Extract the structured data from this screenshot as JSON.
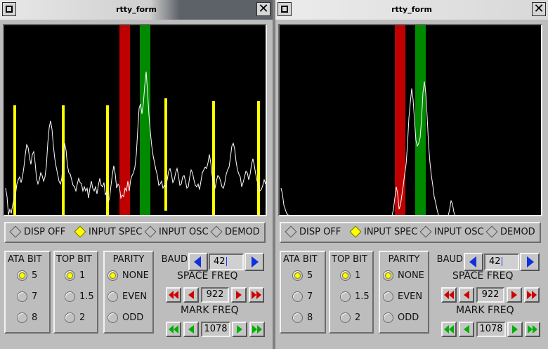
{
  "windows": [
    {
      "title": "rtty_form",
      "active": true,
      "scope": {
        "markers": {
          "space_color": "#c00000",
          "mark_color": "#008a00",
          "bit_marker_color": "#ffff00"
        },
        "trace_color": "#ffffff",
        "bit_markers": true,
        "trace": [
          [
            2,
            232
          ],
          [
            4,
            244
          ],
          [
            6,
            270
          ],
          [
            8,
            262
          ],
          [
            10,
            268
          ],
          [
            12,
            256
          ],
          [
            14,
            248
          ],
          [
            16,
            242
          ],
          [
            18,
            226
          ],
          [
            20,
            220
          ],
          [
            22,
            216
          ],
          [
            24,
            224
          ],
          [
            26,
            216
          ],
          [
            28,
            202
          ],
          [
            30,
            184
          ],
          [
            32,
            170
          ],
          [
            34,
            174
          ],
          [
            36,
            188
          ],
          [
            38,
            198
          ],
          [
            40,
            184
          ],
          [
            42,
            180
          ],
          [
            44,
            196
          ],
          [
            46,
            218
          ],
          [
            48,
            226
          ],
          [
            50,
            220
          ],
          [
            52,
            210
          ],
          [
            54,
            214
          ],
          [
            56,
            222
          ],
          [
            58,
            216
          ],
          [
            60,
            200
          ],
          [
            62,
            168
          ],
          [
            64,
            146
          ],
          [
            66,
            136
          ],
          [
            68,
            148
          ],
          [
            70,
            172
          ],
          [
            72,
            190
          ],
          [
            74,
            202
          ],
          [
            76,
            212
          ],
          [
            78,
            222
          ],
          [
            80,
            226
          ],
          [
            82,
            218
          ],
          [
            84,
            190
          ],
          [
            86,
            168
          ],
          [
            88,
            178
          ],
          [
            90,
            200
          ],
          [
            92,
            210
          ],
          [
            94,
            212
          ],
          [
            96,
            220
          ],
          [
            98,
            228
          ],
          [
            100,
            230
          ],
          [
            102,
            236
          ],
          [
            104,
            226
          ],
          [
            106,
            218
          ],
          [
            108,
            224
          ],
          [
            110,
            226
          ],
          [
            112,
            236
          ],
          [
            114,
            230
          ],
          [
            116,
            236
          ],
          [
            118,
            232
          ],
          [
            120,
            246
          ],
          [
            122,
            232
          ],
          [
            124,
            222
          ],
          [
            126,
            232
          ],
          [
            128,
            236
          ],
          [
            130,
            230
          ],
          [
            132,
            240
          ],
          [
            134,
            228
          ],
          [
            136,
            218
          ],
          [
            138,
            228
          ],
          [
            140,
            230
          ],
          [
            142,
            224
          ],
          [
            144,
            242
          ],
          [
            146,
            236
          ],
          [
            148,
            252
          ],
          [
            150,
            246
          ],
          [
            152,
            228
          ],
          [
            154,
            212
          ],
          [
            156,
            200
          ],
          [
            158,
            212
          ],
          [
            160,
            232
          ],
          [
            162,
            226
          ],
          [
            164,
            230
          ],
          [
            166,
            246
          ],
          [
            168,
            242
          ],
          [
            170,
            244
          ],
          [
            172,
            232
          ],
          [
            174,
            236
          ],
          [
            176,
            222
          ],
          [
            178,
            236
          ],
          [
            180,
            220
          ],
          [
            182,
            214
          ],
          [
            184,
            210
          ],
          [
            186,
            202
          ],
          [
            188,
            184
          ],
          [
            190,
            150
          ],
          [
            192,
            118
          ],
          [
            194,
            112
          ],
          [
            196,
            126
          ],
          [
            198,
            112
          ],
          [
            200,
            86
          ],
          [
            202,
            66
          ],
          [
            204,
            94
          ],
          [
            206,
            128
          ],
          [
            208,
            152
          ],
          [
            210,
            172
          ],
          [
            212,
            186
          ],
          [
            214,
            196
          ],
          [
            216,
            206
          ],
          [
            218,
            214
          ],
          [
            220,
            228
          ],
          [
            222,
            226
          ],
          [
            224,
            222
          ],
          [
            226,
            232
          ],
          [
            228,
            228
          ],
          [
            230,
            230
          ],
          [
            232,
            220
          ],
          [
            234,
            208
          ],
          [
            236,
            204
          ],
          [
            238,
            212
          ],
          [
            240,
            224
          ],
          [
            242,
            220
          ],
          [
            244,
            210
          ],
          [
            246,
            204
          ],
          [
            248,
            214
          ],
          [
            250,
            228
          ],
          [
            252,
            226
          ],
          [
            254,
            216
          ],
          [
            256,
            214
          ],
          [
            258,
            222
          ],
          [
            260,
            232
          ],
          [
            262,
            230
          ],
          [
            264,
            216
          ],
          [
            266,
            206
          ],
          [
            268,
            210
          ],
          [
            270,
            220
          ],
          [
            272,
            228
          ],
          [
            274,
            230
          ],
          [
            276,
            226
          ],
          [
            278,
            234
          ],
          [
            280,
            222
          ],
          [
            282,
            210
          ],
          [
            284,
            206
          ],
          [
            286,
            202
          ],
          [
            288,
            204
          ],
          [
            290,
            196
          ],
          [
            292,
            184
          ],
          [
            294,
            196
          ],
          [
            296,
            214
          ],
          [
            298,
            226
          ],
          [
            300,
            232
          ],
          [
            302,
            222
          ],
          [
            304,
            214
          ],
          [
            306,
            216
          ],
          [
            308,
            222
          ],
          [
            310,
            230
          ],
          [
            312,
            232
          ],
          [
            314,
            224
          ],
          [
            316,
            212
          ],
          [
            318,
            206
          ],
          [
            320,
            202
          ],
          [
            322,
            188
          ],
          [
            324,
            172
          ],
          [
            326,
            168
          ],
          [
            328,
            176
          ],
          [
            330,
            194
          ],
          [
            332,
            206
          ],
          [
            334,
            212
          ],
          [
            336,
            216
          ],
          [
            338,
            230
          ],
          [
            340,
            224
          ],
          [
            342,
            216
          ],
          [
            344,
            208
          ],
          [
            346,
            210
          ],
          [
            348,
            220
          ],
          [
            350,
            212
          ],
          [
            352,
            198
          ],
          [
            354,
            190
          ],
          [
            356,
            200
          ],
          [
            358,
            212
          ],
          [
            360,
            222
          ],
          [
            362,
            226
          ],
          [
            364,
            236
          ],
          [
            366,
            234
          ],
          [
            368,
            228
          ],
          [
            370,
            220
          ],
          [
            372,
            226
          ]
        ]
      },
      "modes": [
        {
          "label": "DISP OFF",
          "selected": false
        },
        {
          "label": "INPUT SPEC",
          "selected": true
        },
        {
          "label": "INPUT OSC",
          "selected": false
        },
        {
          "label": "DEMOD",
          "selected": false
        }
      ],
      "groups": {
        "data_bits": {
          "label": "ATA BIT",
          "options": [
            "5",
            "7",
            "8"
          ],
          "selected": "5"
        },
        "stop_bits": {
          "label": "TOP BIT",
          "options": [
            "1",
            "1.5",
            "2"
          ],
          "selected": "1"
        },
        "parity": {
          "label": "PARITY",
          "options": [
            "NONE",
            "EVEN",
            "ODD"
          ],
          "selected": "NONE"
        }
      },
      "baud": {
        "label": "BAUD",
        "value": "42"
      },
      "space_freq": {
        "label": "SPACE FREQ",
        "value": "922"
      },
      "mark_freq": {
        "label": "MARK FREQ",
        "value": "1078"
      }
    },
    {
      "title": "rtty_form",
      "active": false,
      "scope": {
        "markers": {
          "space_color": "#c00000",
          "mark_color": "#008a00",
          "bit_marker_color": "#ffff00"
        },
        "trace_color": "#ffffff",
        "bit_markers": false,
        "trace": [
          [
            2,
            232
          ],
          [
            4,
            240
          ],
          [
            6,
            256
          ],
          [
            8,
            262
          ],
          [
            10,
            268
          ],
          [
            12,
            270
          ],
          [
            14,
            271
          ],
          [
            160,
            271
          ],
          [
            162,
            262
          ],
          [
            164,
            246
          ],
          [
            166,
            230
          ],
          [
            168,
            240
          ],
          [
            170,
            262
          ],
          [
            172,
            256
          ],
          [
            174,
            242
          ],
          [
            176,
            228
          ],
          [
            178,
            212
          ],
          [
            180,
            198
          ],
          [
            182,
            170
          ],
          [
            184,
            132
          ],
          [
            186,
            110
          ],
          [
            188,
            90
          ],
          [
            190,
            106
          ],
          [
            192,
            136
          ],
          [
            194,
            164
          ],
          [
            196,
            172
          ],
          [
            198,
            168
          ],
          [
            200,
            160
          ],
          [
            202,
            134
          ],
          [
            204,
            96
          ],
          [
            206,
            80
          ],
          [
            208,
            96
          ],
          [
            210,
            130
          ],
          [
            212,
            170
          ],
          [
            214,
            196
          ],
          [
            216,
            214
          ],
          [
            218,
            228
          ],
          [
            220,
            244
          ],
          [
            222,
            252
          ],
          [
            224,
            262
          ],
          [
            226,
            270
          ],
          [
            228,
            271
          ],
          [
            240,
            271
          ],
          [
            242,
            262
          ],
          [
            244,
            250
          ],
          [
            246,
            254
          ],
          [
            248,
            266
          ],
          [
            250,
            271
          ],
          [
            372,
            271
          ]
        ]
      },
      "modes": [
        {
          "label": "DISP OFF",
          "selected": false
        },
        {
          "label": "INPUT SPEC",
          "selected": true
        },
        {
          "label": "INPUT OSC",
          "selected": false
        },
        {
          "label": "DEMOD",
          "selected": false
        }
      ],
      "groups": {
        "data_bits": {
          "label": "ATA BIT",
          "options": [
            "5",
            "7",
            "8"
          ],
          "selected": "5"
        },
        "stop_bits": {
          "label": "TOP BIT",
          "options": [
            "1",
            "1.5",
            "2"
          ],
          "selected": "1"
        },
        "parity": {
          "label": "PARITY",
          "options": [
            "NONE",
            "EVEN",
            "ODD"
          ],
          "selected": "NONE"
        }
      },
      "baud": {
        "label": "BAUD",
        "value": "42"
      },
      "space_freq": {
        "label": "SPACE FREQ",
        "value": "922"
      },
      "mark_freq": {
        "label": "MARK FREQ",
        "value": "1078"
      }
    }
  ]
}
